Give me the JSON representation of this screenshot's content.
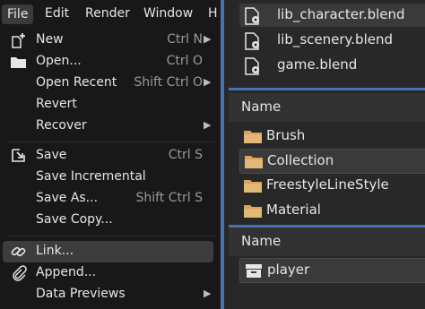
{
  "menubar": {
    "file": "File",
    "edit": "Edit",
    "render": "Render",
    "window": "Window",
    "help_partial": "H"
  },
  "file_menu": {
    "new": {
      "label": "New",
      "shortcut": "Ctrl N"
    },
    "open": {
      "label": "Open...",
      "shortcut": "Ctrl O"
    },
    "open_recent": {
      "label": "Open Recent",
      "shortcut": "Shift Ctrl O"
    },
    "revert": {
      "label": "Revert"
    },
    "recover": {
      "label": "Recover"
    },
    "save": {
      "label": "Save",
      "shortcut": "Ctrl S"
    },
    "save_incremental": {
      "label": "Save Incremental"
    },
    "save_as": {
      "label": "Save As...",
      "shortcut": "Shift Ctrl S"
    },
    "save_copy": {
      "label": "Save Copy..."
    },
    "link": {
      "label": "Link..."
    },
    "append": {
      "label": "Append..."
    },
    "data_previews": {
      "label": "Data Previews"
    }
  },
  "files": [
    {
      "name": "lib_character.blend"
    },
    {
      "name": "lib_scenery.blend"
    },
    {
      "name": "game.blend"
    }
  ],
  "categories": {
    "header": "Name",
    "items": [
      "Brush",
      "Collection",
      "FreestyleLineStyle",
      "Material"
    ]
  },
  "objects": {
    "header": "Name",
    "items": [
      "player"
    ]
  }
}
